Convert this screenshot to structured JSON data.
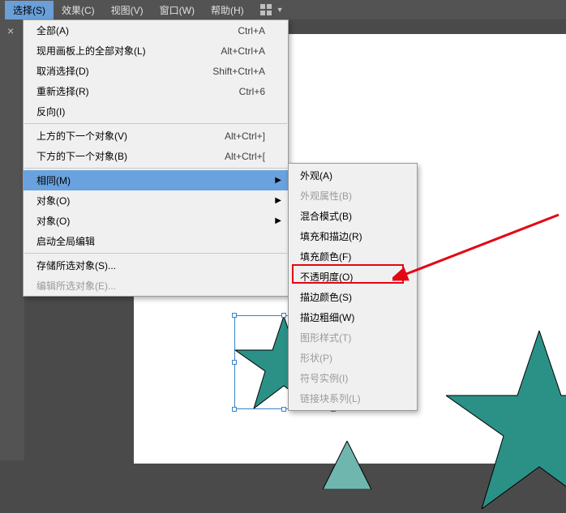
{
  "menubar": {
    "select": "选择(S)",
    "effect": "效果(C)",
    "view": "视图(V)",
    "window": "窗口(W)",
    "help": "帮助(H)"
  },
  "menu": {
    "all": {
      "label": "全部(A)",
      "shortcut": "Ctrl+A"
    },
    "allOnArtboard": {
      "label": "现用画板上的全部对象(L)",
      "shortcut": "Alt+Ctrl+A"
    },
    "deselect": {
      "label": "取消选择(D)",
      "shortcut": "Shift+Ctrl+A"
    },
    "reselect": {
      "label": "重新选择(R)",
      "shortcut": "Ctrl+6"
    },
    "inverse": {
      "label": "反向(I)",
      "shortcut": ""
    },
    "nextAbove": {
      "label": "上方的下一个对象(V)",
      "shortcut": "Alt+Ctrl+]"
    },
    "nextBelow": {
      "label": "下方的下一个对象(B)",
      "shortcut": "Alt+Ctrl+["
    },
    "same": {
      "label": "相同(M)"
    },
    "object": {
      "label": "对象(O)"
    },
    "object2": {
      "label": "对象(O)"
    },
    "startGlobalEdit": {
      "label": "启动全局编辑"
    },
    "saveSelection": {
      "label": "存储所选对象(S)..."
    },
    "editSelection": {
      "label": "编辑所选对象(E)..."
    }
  },
  "submenu": {
    "appearance": "外观(A)",
    "appearanceAttr": "外观属性(B)",
    "blendMode": "混合模式(B)",
    "fillAndStroke": "填充和描边(R)",
    "fillColor": "填充颜色(F)",
    "opacity": "不透明度(O)",
    "strokeColor": "描边颜色(S)",
    "strokeWeight": "描边粗细(W)",
    "graphicStyle": "图形样式(T)",
    "shape": "形状(P)",
    "symbolInstance": "符号实例(I)",
    "linkBlockSeries": "链接块系列(L)"
  },
  "colors": {
    "teal": "#2b9186",
    "tealDark": "#187067",
    "tealTri": "#6fb6ae"
  }
}
